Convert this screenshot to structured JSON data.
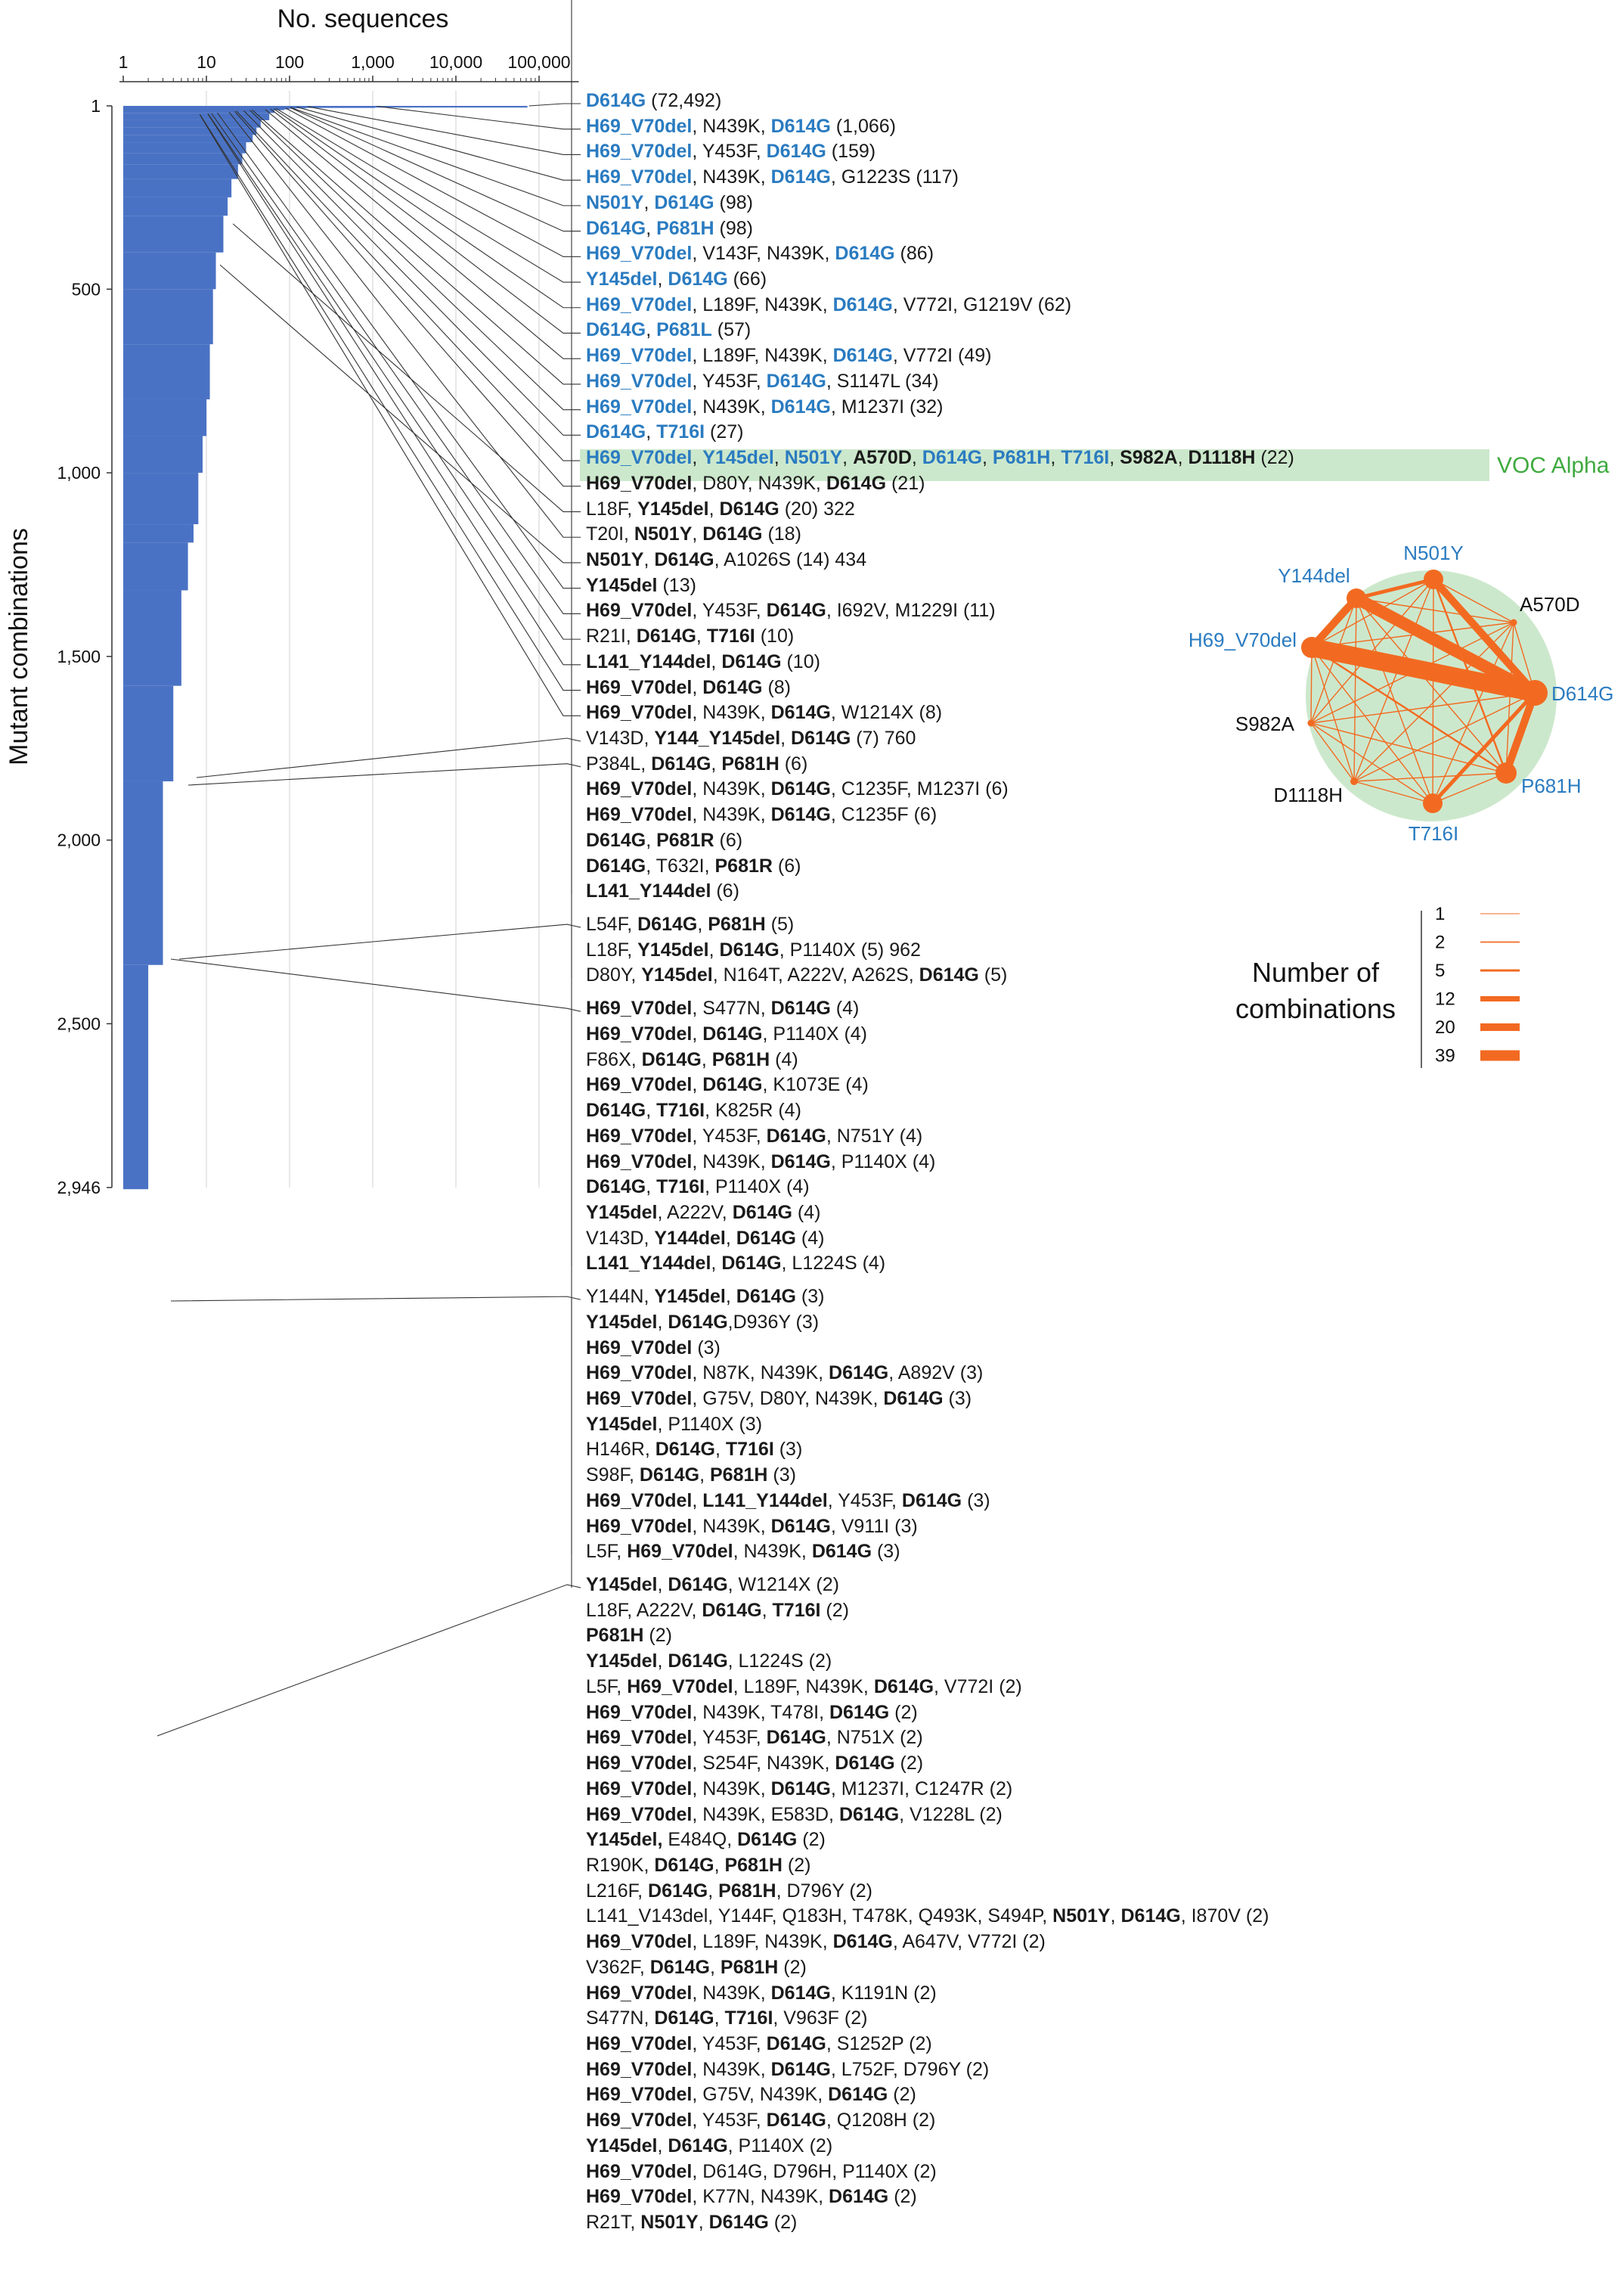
{
  "figure": {
    "x_title": "No. sequences",
    "y_title": "Mutant combinations",
    "x_ticks": [
      "1",
      "10",
      "100",
      "1,000",
      "10,000",
      "100,000"
    ],
    "y_ticks": [
      "1",
      "500",
      "1,000",
      "1,500",
      "2,000",
      "2,500",
      "2,946"
    ],
    "voc_label": "VOC Alpha",
    "legend_title_1": "Number of",
    "legend_title_2": "combinations",
    "colors": {
      "bar": "#4a72c4",
      "edge": "#f26a21",
      "label_blue": "#2a7bc0",
      "highlight": "#cce8cc",
      "voc_text": "#3faa3f"
    }
  },
  "chart_data": [
    {
      "type": "bar",
      "orientation": "horizontal",
      "x_scale": "log",
      "xlim": [
        1,
        300000
      ],
      "ylim": [
        1,
        2946
      ],
      "xlabel": "No. sequences",
      "ylabel": "Mutant combinations",
      "profile": [
        [
          1,
          72492
        ],
        [
          2,
          1066
        ],
        [
          3,
          159
        ],
        [
          4,
          117
        ],
        [
          6,
          98
        ],
        [
          8,
          86
        ],
        [
          10,
          66
        ],
        [
          20,
          57
        ],
        [
          40,
          45
        ],
        [
          60,
          40
        ],
        [
          80,
          36
        ],
        [
          100,
          30
        ],
        [
          130,
          27
        ],
        [
          160,
          24
        ],
        [
          200,
          20
        ],
        [
          250,
          18
        ],
        [
          300,
          16
        ],
        [
          400,
          13
        ],
        [
          500,
          12
        ],
        [
          650,
          11
        ],
        [
          800,
          10
        ],
        [
          900,
          9
        ],
        [
          1000,
          8
        ],
        [
          1140,
          7
        ],
        [
          1190,
          6
        ],
        [
          1320,
          5
        ],
        [
          1580,
          4
        ],
        [
          1840,
          3
        ],
        [
          2340,
          2
        ],
        [
          2946,
          2
        ]
      ],
      "labels": [
        {
          "rank": 1,
          "count": 72492,
          "text": "[[D614G]] (72,492)"
        },
        {
          "rank": 2,
          "count": 1066,
          "text": "[[H69_V70del]], N439K, [[D614G]] (1,066)"
        },
        {
          "rank": 3,
          "count": 159,
          "text": "[[H69_V70del]], Y453F, [[D614G]] (159)"
        },
        {
          "rank": 4,
          "count": 117,
          "text": "[[H69_V70del]], N439K, [[D614G]], G1223S (117)"
        },
        {
          "rank": 5,
          "count": 98,
          "text": "[[N501Y]], [[D614G]] (98)"
        },
        {
          "rank": 6,
          "count": 98,
          "text": "[[D614G]], [[P681H]] (98)"
        },
        {
          "rank": 7,
          "count": 86,
          "text": "[[H69_V70del]], V143F, N439K, [[D614G]] (86)"
        },
        {
          "rank": 8,
          "count": 66,
          "text": "[[Y145del]], [[D614G]] (66)"
        },
        {
          "rank": 9,
          "count": 62,
          "text": "[[H69_V70del]], L189F, N439K, [[D614G]], V772I, G1219V (62)"
        },
        {
          "rank": 10,
          "count": 57,
          "text": "[[D614G]], [[P681L]] (57)"
        },
        {
          "rank": 11,
          "count": 49,
          "text": "[[H69_V70del]], L189F, N439K, [[D614G]], V772I (49)"
        },
        {
          "rank": 12,
          "count": 34,
          "text": "[[H69_V70del]], Y453F, [[D614G]], S1147L (34)"
        },
        {
          "rank": 13,
          "count": 32,
          "text": "[[H69_V70del]], N439K, [[D614G]], M1237I (32)"
        },
        {
          "rank": 14,
          "count": 27,
          "text": "[[D614G]], [[T716I]] (27)"
        },
        {
          "rank": 15,
          "count": 22,
          "text": "[[H69_V70del]], [[Y145del]], [[N501Y]], **A570D**, [[D614G]], [[P681H]], [[T716I]], **S982A**, **D1118H** (22)"
        },
        {
          "rank": 16,
          "count": 21,
          "text": "**H69_V70del**, D80Y, N439K, **D614G** (21)"
        },
        {
          "rank": 322,
          "count": 20,
          "text": "L18F, **Y145del**, **D614G** (20) 322"
        },
        {
          "rank": 18,
          "count": 18,
          "text": "T20I, **N501Y**, **D614G** (18)"
        },
        {
          "rank": 434,
          "count": 14,
          "text": "**N501Y**, **D614G**, A1026S (14) 434"
        },
        {
          "rank": 20,
          "count": 13,
          "text": "**Y145del** (13)"
        },
        {
          "rank": 21,
          "count": 11,
          "text": "**H69_V70del**, Y453F, **D614G**, I692V, M1229I (11)"
        },
        {
          "rank": 22,
          "count": 10,
          "text": "R21I, **D614G**, **T716I** (10)"
        },
        {
          "rank": 23,
          "count": 10,
          "text": "**L141_Y144del**, **D614G** (10)"
        },
        {
          "rank": 24,
          "count": 8,
          "text": "**H69_V70del**, **D614G** (8)"
        },
        {
          "rank": 25,
          "count": 8,
          "text": "**H69_V70del**, N439K, **D614G**, W1214X (8)"
        },
        {
          "rank": 760,
          "count": 7,
          "text": "V143D, **Y144_Y145del**, **D614G** (7) 760"
        },
        {
          "rank": 27,
          "count": 6,
          "text": "P384L, **D614G**, **P681H** (6)"
        },
        {
          "rank": 28,
          "count": 6,
          "text": "**H69_V70del**, N439K, **D614G**, C1235F, M1237I (6)"
        },
        {
          "rank": 29,
          "count": 6,
          "text": "**H69_V70del**, N439K, **D614G**, C1235F (6)"
        },
        {
          "rank": 30,
          "count": 6,
          "text": "**D614G**, **P681R** (6)"
        },
        {
          "rank": 31,
          "count": 6,
          "text": "**D614G**, T632I, **P681R** (6)"
        },
        {
          "rank": 32,
          "count": 6,
          "text": "**L141_Y144del** (6)"
        },
        {
          "rank": 33,
          "count": 5,
          "text": "L54F, **D614G**, **P681H** (5)"
        },
        {
          "rank": 962,
          "count": 5,
          "text": "L18F, **Y145del**, **D614G**, P1140X (5) 962"
        },
        {
          "rank": 35,
          "count": 5,
          "text": "D80Y, **Y145del**, N164T, A222V, A262S, **D614G** (5)"
        },
        {
          "rank": 36,
          "count": 4,
          "text": "**H69_V70del**, S477N, **D614G** (4)"
        },
        {
          "rank": 37,
          "count": 4,
          "text": "**H69_V70del**, **D614G**, P1140X (4)"
        },
        {
          "rank": 38,
          "count": 4,
          "text": "F86X, **D614G**, **P681H** (4)"
        },
        {
          "rank": 39,
          "count": 4,
          "text": "**H69_V70del**, **D614G**, K1073E (4)"
        },
        {
          "rank": 40,
          "count": 4,
          "text": "**D614G**, **T716I**, K825R (4)"
        },
        {
          "rank": 41,
          "count": 4,
          "text": "**H69_V70del**, Y453F, **D614G**, N751Y (4)"
        },
        {
          "rank": 42,
          "count": 4,
          "text": "**H69_V70del**, N439K, **D614G**, P1140X (4)"
        },
        {
          "rank": 43,
          "count": 4,
          "text": "**D614G**, **T716I**, P1140X (4)"
        },
        {
          "rank": 44,
          "count": 4,
          "text": "**Y145del**, A222V, **D614G** (4)"
        },
        {
          "rank": 45,
          "count": 4,
          "text": "V143D, **Y144del**, **D614G** (4)"
        },
        {
          "rank": 46,
          "count": 4,
          "text": "**L141_Y144del**, **D614G**, L1224S (4)"
        },
        {
          "rank": 47,
          "count": 3,
          "text": "Y144N, **Y145del**, **D614G** (3)"
        },
        {
          "rank": 48,
          "count": 3,
          "text": "**Y145del**, **D614G**,D936Y (3)"
        },
        {
          "rank": 49,
          "count": 3,
          "text": "**H69_V70del** (3)"
        },
        {
          "rank": 50,
          "count": 3,
          "text": "**H69_V70del**, N87K, N439K, **D614G**, A892V (3)"
        },
        {
          "rank": 51,
          "count": 3,
          "text": "**H69_V70del**, G75V, D80Y, N439K, **D614G** (3)"
        },
        {
          "rank": 52,
          "count": 3,
          "text": "**Y145del**, P1140X (3)"
        },
        {
          "rank": 53,
          "count": 3,
          "text": "H146R, **D614G**, **T716I** (3)"
        },
        {
          "rank": 54,
          "count": 3,
          "text": "S98F, **D614G**, **P681H** (3)"
        },
        {
          "rank": 55,
          "count": 3,
          "text": "**H69_V70del**, **L141_Y144del**, Y453F, **D614G** (3)"
        },
        {
          "rank": 56,
          "count": 3,
          "text": "**H69_V70del**, N439K, **D614G**, V911I (3)"
        },
        {
          "rank": 57,
          "count": 3,
          "text": "L5F, **H69_V70del**, N439K, **D614G** (3)"
        },
        {
          "rank": 58,
          "count": 2,
          "text": "**Y145del**, **D614G**, W1214X (2)"
        },
        {
          "rank": 59,
          "count": 2,
          "text": "L18F, A222V, **D614G**, **T716I** (2)"
        },
        {
          "rank": 60,
          "count": 2,
          "text": "**P681H** (2)"
        },
        {
          "rank": 61,
          "count": 2,
          "text": "**Y145del**, **D614G**, L1224S (2)"
        },
        {
          "rank": 62,
          "count": 2,
          "text": "L5F, **H69_V70del**, L189F, N439K, **D614G**, V772I (2)"
        },
        {
          "rank": 63,
          "count": 2,
          "text": "**H69_V70del**, N439K, T478I, **D614G** (2)"
        },
        {
          "rank": 64,
          "count": 2,
          "text": "**H69_V70del**, Y453F, **D614G**, N751X (2)"
        },
        {
          "rank": 65,
          "count": 2,
          "text": "**H69_V70del**, S254F, N439K, **D614G** (2)"
        },
        {
          "rank": 66,
          "count": 2,
          "text": "**H69_V70del**, N439K, **D614G**, M1237I, C1247R (2)"
        },
        {
          "rank": 67,
          "count": 2,
          "text": "**H69_V70del**, N439K, E583D, **D614G**, V1228L (2)"
        },
        {
          "rank": 68,
          "count": 2,
          "text": "**Y145del,** E484Q, **D614G** (2)"
        },
        {
          "rank": 69,
          "count": 2,
          "text": "R190K, **D614G**, **P681H** (2)"
        },
        {
          "rank": 70,
          "count": 2,
          "text": "L216F, **D614G**, **P681H**, D796Y (2)"
        },
        {
          "rank": 71,
          "count": 2,
          "text": "L141_V143del, Y144F, Q183H, T478K, Q493K, S494P, **N501Y**, **D614G**, I870V (2)"
        },
        {
          "rank": 72,
          "count": 2,
          "text": "**H69_V70del**, L189F, N439K, **D614G**, A647V, V772I (2)"
        },
        {
          "rank": 73,
          "count": 2,
          "text": "V362F, **D614G**, **P681H** (2)"
        },
        {
          "rank": 74,
          "count": 2,
          "text": "**H69_V70del**, N439K, **D614G**, K1191N (2)"
        },
        {
          "rank": 75,
          "count": 2,
          "text": "S477N, **D614G**, **T716I**, V963F (2)"
        },
        {
          "rank": 76,
          "count": 2,
          "text": "**H69_V70del**, Y453F, **D614G**, S1252P (2)"
        },
        {
          "rank": 77,
          "count": 2,
          "text": "**H69_V70del**, N439K, **D614G**, L752F, D796Y (2)"
        },
        {
          "rank": 78,
          "count": 2,
          "text": "**H69_V70del**, G75V, N439K, **D614G** (2)"
        },
        {
          "rank": 79,
          "count": 2,
          "text": "**H69_V70del**, Y453F, **D614G**, Q1208H (2)"
        },
        {
          "rank": 80,
          "count": 2,
          "text": "**Y145del**, **D614G**, P1140X (2)"
        },
        {
          "rank": 81,
          "count": 2,
          "text": "**H69_V70del**, D614G, D796H, P1140X (2)"
        },
        {
          "rank": 82,
          "count": 2,
          "text": "**H69_V70del**, K77N, N439K, **D614G** (2)"
        },
        {
          "rank": 83,
          "count": 2,
          "text": "R21T, **N501Y**, **D614G** (2)"
        }
      ]
    },
    {
      "type": "network",
      "nodes": [
        {
          "label": "N501Y",
          "color": "#2a7bc0",
          "size": 12
        },
        {
          "label": "A570D",
          "color": "#111111",
          "size": 1
        },
        {
          "label": "D614G",
          "color": "#2a7bc0",
          "size": 39
        },
        {
          "label": "P681H",
          "color": "#2a7bc0",
          "size": 20
        },
        {
          "label": "T716I",
          "color": "#2a7bc0",
          "size": 12
        },
        {
          "label": "D1118H",
          "color": "#111111",
          "size": 2
        },
        {
          "label": "S982A",
          "color": "#111111",
          "size": 1
        },
        {
          "label": "H69_V70del",
          "color": "#2a7bc0",
          "size": 20
        },
        {
          "label": "Y144del",
          "color": "#2a7bc0",
          "size": 12
        }
      ],
      "edges": [
        [
          "H69_V70del",
          "D614G",
          39
        ],
        [
          "Y144del",
          "D614G",
          20
        ],
        [
          "H69_V70del",
          "Y144del",
          12
        ],
        [
          "N501Y",
          "D614G",
          12
        ],
        [
          "D614G",
          "P681H",
          12
        ],
        [
          "D614G",
          "T716I",
          5
        ],
        [
          "Y144del",
          "N501Y",
          5
        ],
        [
          "H69_V70del",
          "P681H",
          2
        ],
        [
          "N501Y",
          "P681H",
          2
        ]
      ],
      "legend": {
        "title": "Number of combinations",
        "levels": [
          1,
          2,
          5,
          12,
          20,
          39
        ]
      }
    }
  ]
}
